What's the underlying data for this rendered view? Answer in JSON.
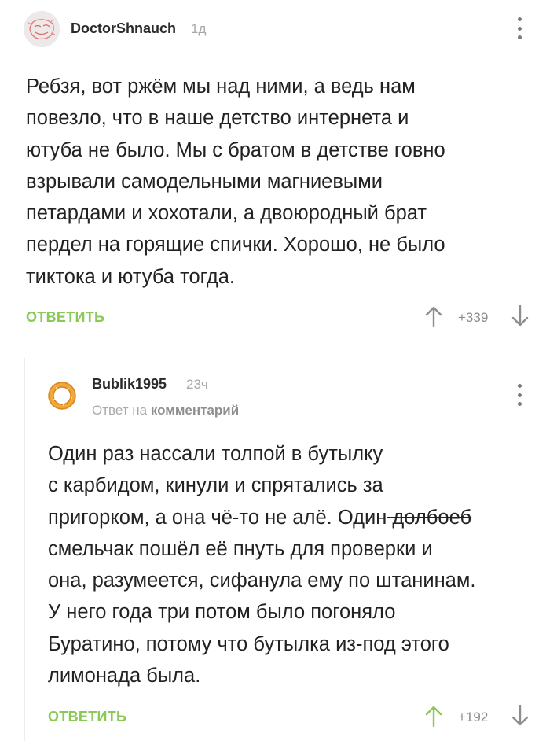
{
  "top_comment": {
    "username": "DoctorShnauch",
    "time": "1д",
    "lines": [
      "Ребзя, вот ржём мы над ними, а ведь нам",
      "повезло, что в наше детство интернета и",
      "ютуба не было. Мы с братом в детстве говно",
      "взрывали самодельными магниевыми",
      "петардами и хохотали, а двоюродный брат",
      "пердел на горящие спички. Хорошо, не было",
      "тиктока и ютуба тогда."
    ],
    "reply_label": "ОТВЕТИТЬ",
    "score": "+339"
  },
  "reply_comment": {
    "username": "Bublik1995",
    "time": "23ч",
    "reply_prefix": "Ответ на",
    "reply_target": "комментарий",
    "line1": "Один раз нассали толпой в бутылку",
    "line2": "с карбидом, кинули и спрятались за",
    "line3_a": "пригорком, а она чё-то не алё. Один",
    "line3_strike": " долбоеб",
    "line4": "смельчак пошёл её пнуть для проверки и",
    "line5": "она, разумеется, сифанула ему по штанинам.",
    "line6": "У него года три потом было погоняло",
    "line7": "Буратино, потому что бутылка из-под этого",
    "line8": "лимонада была.",
    "reply_label": "ОТВЕТИТЬ",
    "score": "+192"
  },
  "colors": {
    "accent_green": "#8ac858",
    "text": "#222222",
    "muted": "#a9a9a9"
  },
  "icons": [
    "avatar-sketch",
    "bagel-avatar",
    "more-vertical-icon",
    "arrow-up-icon",
    "arrow-down-icon"
  ]
}
